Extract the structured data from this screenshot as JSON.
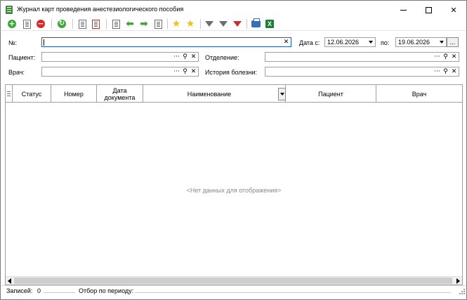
{
  "window": {
    "title": "Журнал карт проведения анестезиологического пособия",
    "minimize": "minimize",
    "maximize": "maximize",
    "close": "✕"
  },
  "toolbar": {
    "items": [
      {
        "icon": "add-icon",
        "glyph": "+",
        "color": "#3ea83a"
      },
      {
        "icon": "edit-document-icon"
      },
      {
        "icon": "delete-icon",
        "glyph": "−",
        "color": "#d62b2b"
      },
      {
        "icon": "refresh-icon",
        "glyph": "↻",
        "color": "#3ea83a"
      },
      {
        "icon": "document-check-icon"
      },
      {
        "icon": "document-delete-icon"
      },
      {
        "icon": "document-list-icon"
      },
      {
        "icon": "arrow-left-icon",
        "glyph": "⬅"
      },
      {
        "icon": "arrow-right-icon",
        "glyph": "➡"
      },
      {
        "icon": "document-next-icon"
      },
      {
        "icon": "favorite-add-icon",
        "glyph": "★"
      },
      {
        "icon": "favorite-icon",
        "glyph": "★"
      },
      {
        "icon": "filter-icon"
      },
      {
        "icon": "filter-edit-icon"
      },
      {
        "icon": "filter-clear-icon"
      },
      {
        "icon": "print-icon"
      },
      {
        "icon": "excel-export-icon",
        "glyph": "X"
      }
    ]
  },
  "filters": {
    "number_label": "№:",
    "number_value": "",
    "date_from_label": "Дата с:",
    "date_from_value": "12.06.2026",
    "date_to_label": "по:",
    "date_to_value": "19.06.2026",
    "period_button": "...",
    "patient_label": "Пациент:",
    "patient_value": "",
    "department_label": "Отделение:",
    "department_value": "",
    "doctor_label": "Врач:",
    "doctor_value": "",
    "history_label": "История болезни:",
    "history_value": "",
    "ellipsis": "···",
    "search_glyph": "⚲",
    "clear_glyph": "✕"
  },
  "grid": {
    "columns": [
      "Статус",
      "Номер",
      "Дата документа",
      "Наименование",
      "Пациент",
      "Врач"
    ],
    "empty_message": "<Нет данных для отображения>"
  },
  "status": {
    "records_label": "Записей:",
    "records_value": "0",
    "period_label": "Отбор по периоду:"
  },
  "colors": {
    "accent": "#1a5fb4",
    "border": "#a0a0a0",
    "add_green": "#3ea83a",
    "delete_red": "#d62b2b"
  }
}
